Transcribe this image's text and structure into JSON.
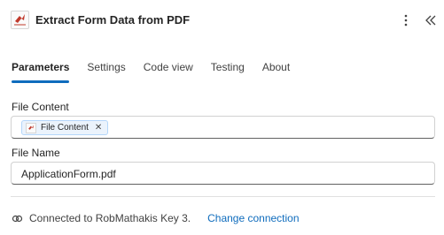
{
  "header": {
    "title": "Extract Form Data from PDF",
    "app_icon": "pdf-action-icon",
    "more_icon": "more-vertical-icon",
    "collapse_icon": "double-chevron-left-icon"
  },
  "tabs": [
    {
      "label": "Parameters",
      "active": true
    },
    {
      "label": "Settings",
      "active": false
    },
    {
      "label": "Code view",
      "active": false
    },
    {
      "label": "Testing",
      "active": false
    },
    {
      "label": "About",
      "active": false
    }
  ],
  "fields": {
    "file_content": {
      "label": "File Content",
      "token_label": "File Content",
      "token_remove": "✕"
    },
    "file_name": {
      "label": "File Name",
      "value": "ApplicationForm.pdf"
    }
  },
  "footer": {
    "connection_icon": "link-connection-icon",
    "connection_text": "Connected to RobMathakis Key 3.",
    "change_link": "Change connection"
  },
  "colors": {
    "accent": "#0f6cbd",
    "token_bg": "#ebf3fc",
    "icon_red": "#c0392b"
  }
}
